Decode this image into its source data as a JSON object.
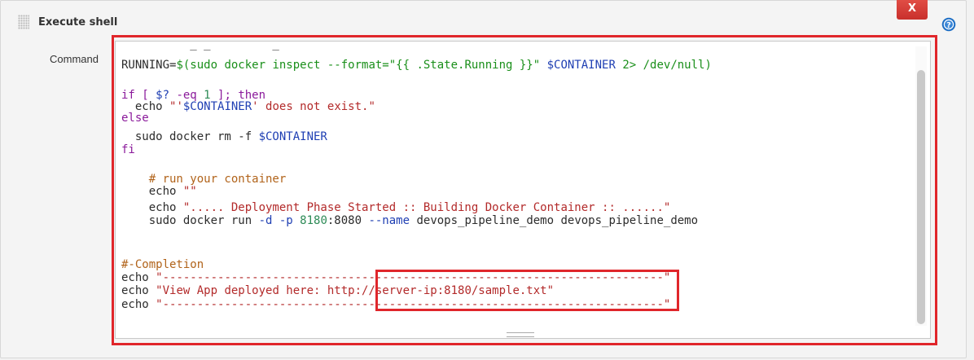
{
  "section": {
    "title": "Execute shell",
    "close_label": "X",
    "help_icon": "help-icon",
    "drag_icon": "drag-handle-icon"
  },
  "command": {
    "label": "Command"
  },
  "code_lines": [
    {
      "segments": [
        {
          "c": "t-def",
          "t": "RUNNING="
        },
        {
          "c": "t-green",
          "t": "$(sudo docker inspect --format=\"{{ .State.Running }}\" "
        },
        {
          "c": "t-var",
          "t": "$CONTAINER"
        },
        {
          "c": "t-green",
          "t": " 2> /dev/null)"
        }
      ]
    },
    {
      "segments": [
        {
          "c": "t-kw",
          "t": "if [ "
        },
        {
          "c": "t-var",
          "t": "$?"
        },
        {
          "c": "t-kw",
          "t": " -eq "
        },
        {
          "c": "t-num",
          "t": "1"
        },
        {
          "c": "t-kw",
          "t": " ]; then"
        }
      ]
    },
    {
      "segments": [
        {
          "c": "t-def",
          "t": "  echo "
        },
        {
          "c": "t-str",
          "t": "\"'"
        },
        {
          "c": "t-var",
          "t": "$CONTAINER"
        },
        {
          "c": "t-str",
          "t": "' does not exist.\""
        }
      ]
    },
    {
      "segments": [
        {
          "c": "t-kw",
          "t": "else"
        }
      ]
    },
    {
      "segments": [
        {
          "c": "t-def",
          "t": "  sudo docker rm -f "
        },
        {
          "c": "t-var",
          "t": "$CONTAINER"
        }
      ]
    },
    {
      "segments": [
        {
          "c": "t-kw",
          "t": "fi"
        }
      ]
    },
    {
      "segments": [
        {
          "c": "t-com",
          "t": "    # run your container"
        }
      ]
    },
    {
      "segments": [
        {
          "c": "t-def",
          "t": "    echo "
        },
        {
          "c": "t-str",
          "t": "\"\""
        }
      ]
    },
    {
      "segments": [
        {
          "c": "t-def",
          "t": "    echo "
        },
        {
          "c": "t-str",
          "t": "\"..... Deployment Phase Started :: Building Docker Container :: ......\""
        }
      ]
    },
    {
      "segments": [
        {
          "c": "t-def",
          "t": "    sudo docker run "
        },
        {
          "c": "t-var",
          "t": "-d -p "
        },
        {
          "c": "t-num",
          "t": "8180"
        },
        {
          "c": "t-def",
          "t": ":8080 "
        },
        {
          "c": "t-var",
          "t": "--name"
        },
        {
          "c": "t-def",
          "t": " devops_pipeline_demo devops_pipeline_demo"
        }
      ]
    },
    {
      "segments": [
        {
          "c": "t-com",
          "t": "#-Completion"
        }
      ]
    },
    {
      "segments": [
        {
          "c": "t-def",
          "t": "echo "
        },
        {
          "c": "t-str",
          "t": "\"-------------------------------------------------------------------------\""
        }
      ]
    },
    {
      "segments": [
        {
          "c": "t-def",
          "t": "echo "
        },
        {
          "c": "t-str",
          "t": "\"View App deployed here: http://server-ip:8180/sample.txt\""
        }
      ]
    },
    {
      "segments": [
        {
          "c": "t-def",
          "t": "echo "
        },
        {
          "c": "t-str",
          "t": "\"-------------------------------------------------------------------------\""
        }
      ]
    }
  ],
  "colors": {
    "highlight": "#e0262b",
    "close_button": "#d43f3a",
    "help_icon": "#1f6fc5"
  }
}
